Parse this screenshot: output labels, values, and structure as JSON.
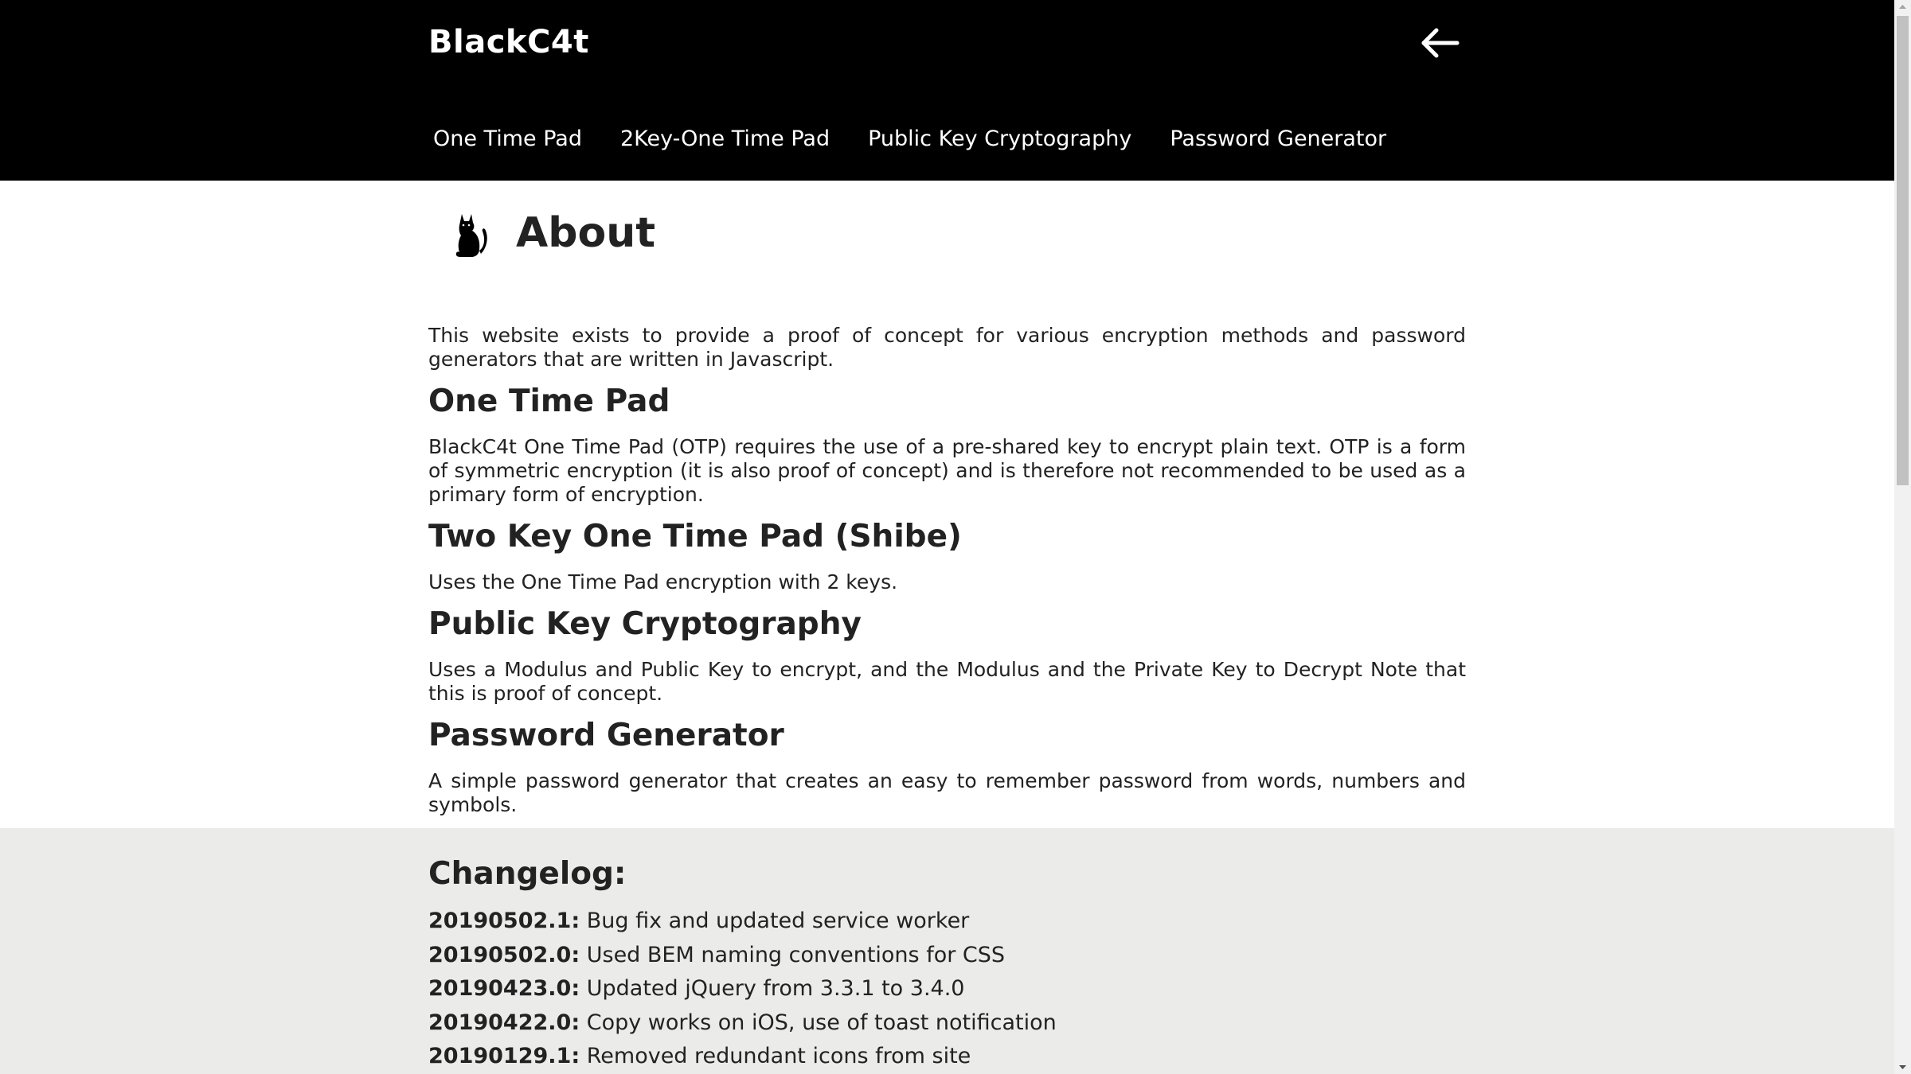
{
  "header": {
    "brand": "BlackC4t",
    "back_icon": "arrow-left-icon",
    "nav": [
      {
        "label": "One Time Pad"
      },
      {
        "label": "2Key-One Time Pad"
      },
      {
        "label": "Public Key Cryptography"
      },
      {
        "label": "Password Generator"
      }
    ]
  },
  "main": {
    "logo_icon": "cat-icon",
    "title": "About",
    "intro": "This website exists to provide a proof of concept for various encryption methods and password generators that are written in Javascript.",
    "sections": [
      {
        "heading": "One Time Pad",
        "text": "BlackC4t One Time Pad (OTP) requires the use of a pre-shared key to encrypt plain text. OTP is a form of symmetric encryption (it is also proof of concept) and is therefore not recommended to be used as a primary form of encryption."
      },
      {
        "heading": "Two Key One Time Pad (Shibe)",
        "text": "Uses the One Time Pad encryption with 2 keys."
      },
      {
        "heading": "Public Key Cryptography",
        "text": "Uses a Modulus and Public Key to encrypt, and the Modulus and the Private Key to Decrypt Note that this is proof of concept."
      },
      {
        "heading": "Password Generator",
        "text": "A simple password generator that creates an easy to remember password from words, numbers and symbols."
      }
    ]
  },
  "changelog": {
    "title": "Changelog:",
    "entries": [
      {
        "version": "20190502.1:",
        "text": "Bug fix and updated service worker"
      },
      {
        "version": "20190502.0:",
        "text": "Used BEM naming conventions for CSS"
      },
      {
        "version": "20190423.0:",
        "text": "Updated jQuery from 3.3.1 to 3.4.0"
      },
      {
        "version": "20190422.0:",
        "text": "Copy works on iOS, use of toast notification"
      },
      {
        "version": "20190129.1:",
        "text": "Removed redundant icons from site"
      }
    ]
  },
  "colors": {
    "header_bg": "#000000",
    "header_text": "#ffffff",
    "body_text": "#222222",
    "changelog_bg": "#ebebe9"
  }
}
